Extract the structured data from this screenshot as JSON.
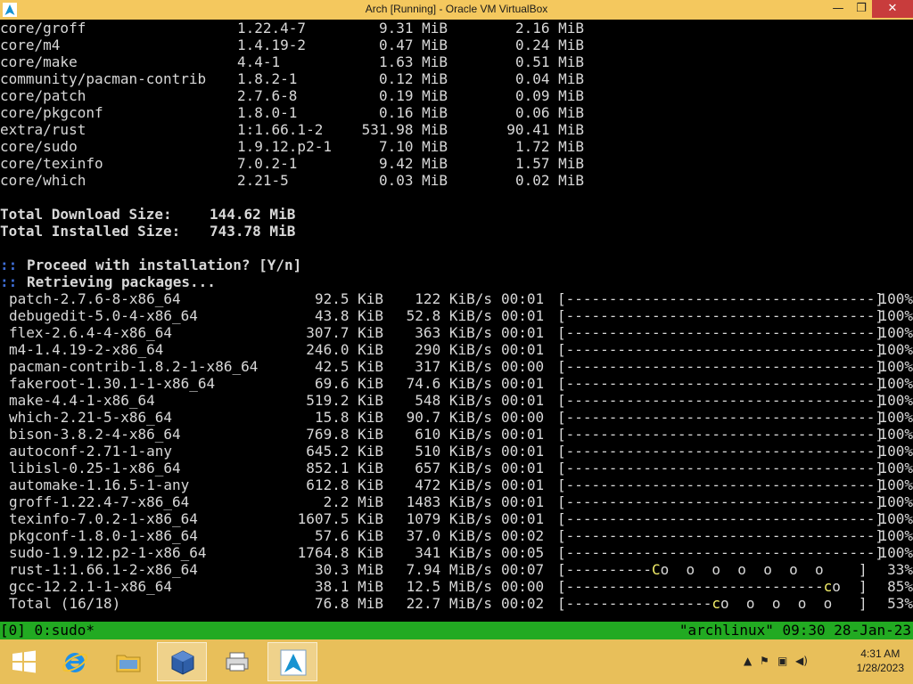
{
  "window": {
    "title": "Arch [Running] - Oracle VM VirtualBox",
    "minimize_glyph": "—",
    "maximize_glyph": "❐",
    "close_glyph": "✕"
  },
  "terminal": {
    "pkg_rows": [
      {
        "name": "core/groff",
        "version": "1.22.4-7",
        "download": "9.31 MiB",
        "installed": "2.16 MiB"
      },
      {
        "name": "core/m4",
        "version": "1.4.19-2",
        "download": "0.47 MiB",
        "installed": "0.24 MiB"
      },
      {
        "name": "core/make",
        "version": "4.4-1",
        "download": "1.63 MiB",
        "installed": "0.51 MiB"
      },
      {
        "name": "community/pacman-contrib",
        "version": "1.8.2-1",
        "download": "0.12 MiB",
        "installed": "0.04 MiB"
      },
      {
        "name": "core/patch",
        "version": "2.7.6-8",
        "download": "0.19 MiB",
        "installed": "0.09 MiB"
      },
      {
        "name": "core/pkgconf",
        "version": "1.8.0-1",
        "download": "0.16 MiB",
        "installed": "0.06 MiB"
      },
      {
        "name": "extra/rust",
        "version": "1:1.66.1-2",
        "download": "531.98 MiB",
        "installed": "90.41 MiB"
      },
      {
        "name": "core/sudo",
        "version": "1.9.12.p2-1",
        "download": "7.10 MiB",
        "installed": "1.72 MiB"
      },
      {
        "name": "core/texinfo",
        "version": "7.0.2-1",
        "download": "9.42 MiB",
        "installed": "1.57 MiB"
      },
      {
        "name": "core/which",
        "version": "2.21-5",
        "download": "0.03 MiB",
        "installed": "0.02 MiB"
      }
    ],
    "total_download_label": "Total Download Size:",
    "total_download_value": "144.62 MiB",
    "total_installed_label": "Total Installed Size:",
    "total_installed_value": "743.78 MiB",
    "prompt_marker": "::",
    "proceed_text": "Proceed with installation? [Y/n]",
    "retrieving_text": "Retrieving packages...",
    "downloads": [
      {
        "name": "patch-2.7.6-8-x86_64",
        "size": "92.5 KiB",
        "rate": "122 KiB/s",
        "time": "00:01",
        "progress": 100,
        "bar": "[------------------------------------]",
        "pct": "100%"
      },
      {
        "name": "debugedit-5.0-4-x86_64",
        "size": "43.8 KiB",
        "rate": "52.8 KiB/s",
        "time": "00:01",
        "progress": 100,
        "bar": "[------------------------------------]",
        "pct": "100%"
      },
      {
        "name": "flex-2.6.4-4-x86_64",
        "size": "307.7 KiB",
        "rate": "363 KiB/s",
        "time": "00:01",
        "progress": 100,
        "bar": "[------------------------------------]",
        "pct": "100%"
      },
      {
        "name": "m4-1.4.19-2-x86_64",
        "size": "246.0 KiB",
        "rate": "290 KiB/s",
        "time": "00:01",
        "progress": 100,
        "bar": "[------------------------------------]",
        "pct": "100%"
      },
      {
        "name": "pacman-contrib-1.8.2-1-x86_64",
        "size": "42.5 KiB",
        "rate": "317 KiB/s",
        "time": "00:00",
        "progress": 100,
        "bar": "[------------------------------------]",
        "pct": "100%"
      },
      {
        "name": "fakeroot-1.30.1-1-x86_64",
        "size": "69.6 KiB",
        "rate": "74.6 KiB/s",
        "time": "00:01",
        "progress": 100,
        "bar": "[------------------------------------]",
        "pct": "100%"
      },
      {
        "name": "make-4.4-1-x86_64",
        "size": "519.2 KiB",
        "rate": "548 KiB/s",
        "time": "00:01",
        "progress": 100,
        "bar": "[------------------------------------]",
        "pct": "100%"
      },
      {
        "name": "which-2.21-5-x86_64",
        "size": "15.8 KiB",
        "rate": "90.7 KiB/s",
        "time": "00:00",
        "progress": 100,
        "bar": "[------------------------------------]",
        "pct": "100%"
      },
      {
        "name": "bison-3.8.2-4-x86_64",
        "size": "769.8 KiB",
        "rate": "610 KiB/s",
        "time": "00:01",
        "progress": 100,
        "bar": "[------------------------------------]",
        "pct": "100%"
      },
      {
        "name": "autoconf-2.71-1-any",
        "size": "645.2 KiB",
        "rate": "510 KiB/s",
        "time": "00:01",
        "progress": 100,
        "bar": "[------------------------------------]",
        "pct": "100%"
      },
      {
        "name": "libisl-0.25-1-x86_64",
        "size": "852.1 KiB",
        "rate": "657 KiB/s",
        "time": "00:01",
        "progress": 100,
        "bar": "[------------------------------------]",
        "pct": "100%"
      },
      {
        "name": "automake-1.16.5-1-any",
        "size": "612.8 KiB",
        "rate": "472 KiB/s",
        "time": "00:01",
        "progress": 100,
        "bar": "[------------------------------------]",
        "pct": "100%"
      },
      {
        "name": "groff-1.22.4-7-x86_64",
        "size": "2.2 MiB",
        "rate": "1483 KiB/s",
        "time": "00:01",
        "progress": 100,
        "bar": "[------------------------------------]",
        "pct": "100%"
      },
      {
        "name": "texinfo-7.0.2-1-x86_64",
        "size": "1607.5 KiB",
        "rate": "1079 KiB/s",
        "time": "00:01",
        "progress": 100,
        "bar": "[------------------------------------]",
        "pct": "100%"
      },
      {
        "name": "pkgconf-1.8.0-1-x86_64",
        "size": "57.6 KiB",
        "rate": "37.0 KiB/s",
        "time": "00:02",
        "progress": 100,
        "bar": "[------------------------------------]",
        "pct": "100%"
      },
      {
        "name": "sudo-1.9.12.p2-1-x86_64",
        "size": "1764.8 KiB",
        "rate": "341 KiB/s",
        "time": "00:05",
        "progress": 100,
        "bar": "[------------------------------------]",
        "pct": "100%"
      },
      {
        "name": "rust-1:1.66.1-2-x86_64",
        "size": "30.3 MiB",
        "rate": "7.94 MiB/s",
        "time": "00:07",
        "progress": 33,
        "bar": "[----------",
        "pacman": "C",
        "dots": "o  o  o  o  o  o  o",
        "bar_end": "]",
        "pct": "33%"
      },
      {
        "name": "gcc-12.2.1-1-x86_64",
        "size": "38.1 MiB",
        "rate": "12.5 MiB/s",
        "time": "00:00",
        "progress": 85,
        "bar": "[------------------------------",
        "pacman": "c",
        "dots": "o",
        "bar_end": "]",
        "pct": "85%"
      },
      {
        "name": "Total (16/18)",
        "size": "76.8 MiB",
        "rate": "22.7 MiB/s",
        "time": "00:02",
        "progress": 53,
        "bar": "[-----------------",
        "pacman": "c",
        "dots": "o  o  o  o  o",
        "bar_end": "]",
        "pct": "53%"
      }
    ]
  },
  "statusbar": {
    "left": "[0] 0:sudo*",
    "right": "\"archlinux\" 09:30 28-Jan-23"
  },
  "taskbar": {
    "apps": [
      {
        "name": "start-button",
        "icon": "windows-logo-icon"
      },
      {
        "name": "internet-explorer",
        "icon": "internet-explorer-icon"
      },
      {
        "name": "file-explorer",
        "icon": "folder-icon"
      },
      {
        "name": "virtualbox-manager",
        "icon": "virtualbox-icon"
      },
      {
        "name": "device-app",
        "icon": "printer-icon"
      },
      {
        "name": "arch-vm",
        "icon": "arch-linux-icon"
      }
    ],
    "clock_time": "4:31 AM",
    "clock_date": "1/28/2023"
  },
  "colors": {
    "title_bar": "#f4c85e",
    "taskbar": "#e8bf5a",
    "tmux_status": "#22aa22",
    "prompt_blue": "#3f6fd8",
    "pacman_yellow": "#f5f06a"
  }
}
